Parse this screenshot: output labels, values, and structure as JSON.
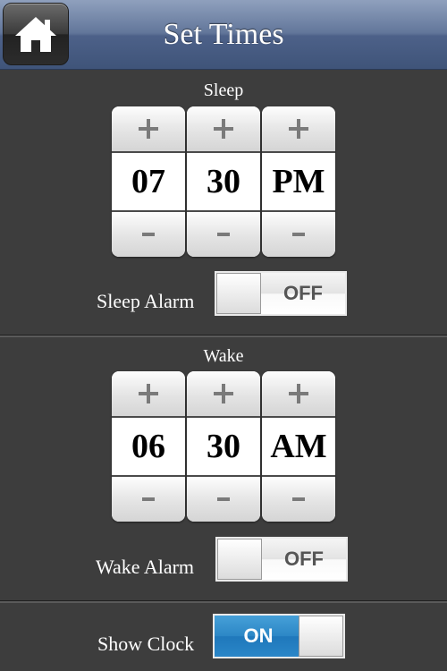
{
  "header": {
    "title": "Set Times",
    "home_icon": "home-icon"
  },
  "sleep": {
    "label": "Sleep",
    "hour": "07",
    "minute": "30",
    "ampm": "PM",
    "plus_label": "+",
    "minus_label": "-",
    "alarm_label": "Sleep Alarm",
    "alarm_state": "OFF"
  },
  "wake": {
    "label": "Wake",
    "hour": "06",
    "minute": "30",
    "ampm": "AM",
    "plus_label": "+",
    "minus_label": "-",
    "alarm_label": "Wake Alarm",
    "alarm_state": "OFF"
  },
  "clock": {
    "label": "Show Clock",
    "state": "ON"
  },
  "colors": {
    "header": "#5a6e93",
    "background": "#3d3d3d",
    "toggle_on": "#2c87c6"
  }
}
